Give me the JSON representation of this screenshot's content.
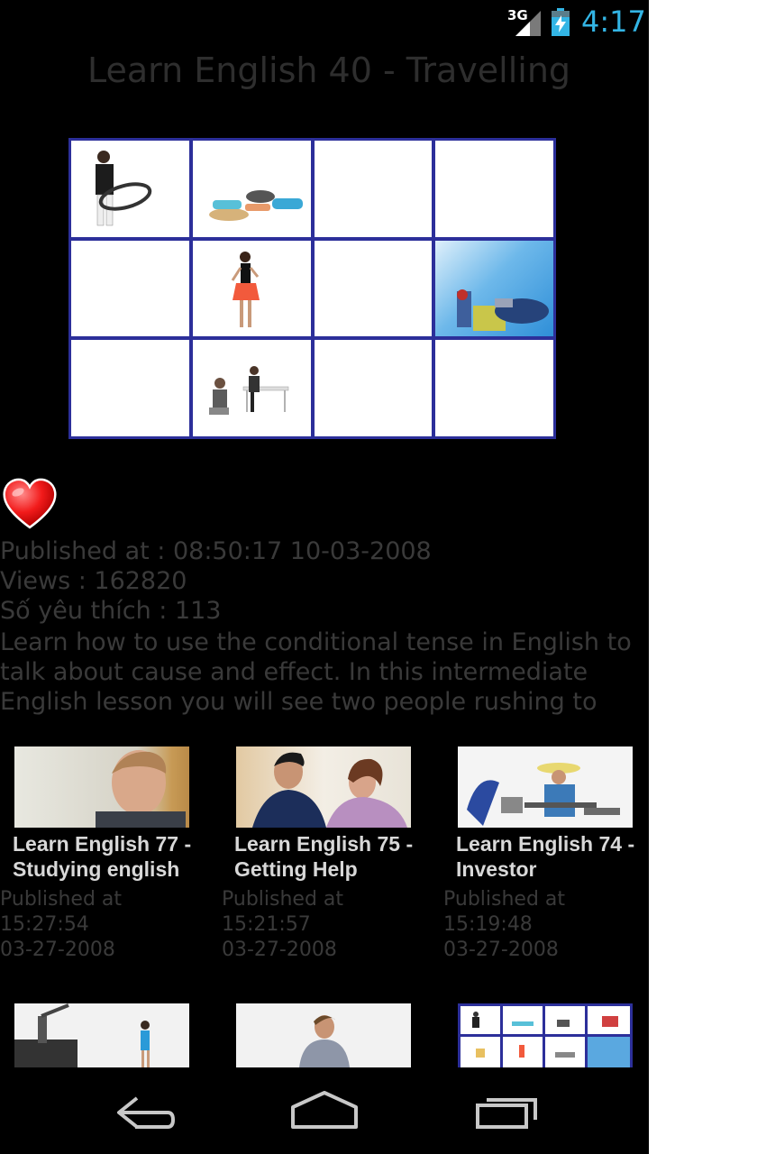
{
  "status_bar": {
    "network": "3G",
    "time": "4:17",
    "time_color": "#33b5e5"
  },
  "title": "Learn English 40 - Travelling",
  "thumbnail_grid": {
    "border_color": "#2c2f9a",
    "rows": 3,
    "columns": 4
  },
  "favorite_icon": "heart-icon",
  "details": {
    "published": "Published at : 08:50:17 10-03-2008",
    "views": "Views : 162820",
    "likes": "Số yêu thích : 113",
    "description": "Learn how to use the conditional tense in English to talk about cause and effect.  In this intermediate English lesson you will see two people rushing to get to the"
  },
  "related": [
    {
      "title": "Learn English 77 - Studying english",
      "pub_label": "Published at",
      "time": "15:27:54",
      "date": "03-27-2008"
    },
    {
      "title": "Learn English 75 - Getting Help",
      "pub_label": "Published at",
      "time": "15:21:57",
      "date": "03-27-2008"
    },
    {
      "title": "Learn English 74 - Investor",
      "pub_label": "Published at",
      "time": "15:19:48",
      "date": "03-27-2008"
    }
  ],
  "nav": {
    "back": "back-icon",
    "home": "home-icon",
    "recents": "recent-apps-icon"
  }
}
